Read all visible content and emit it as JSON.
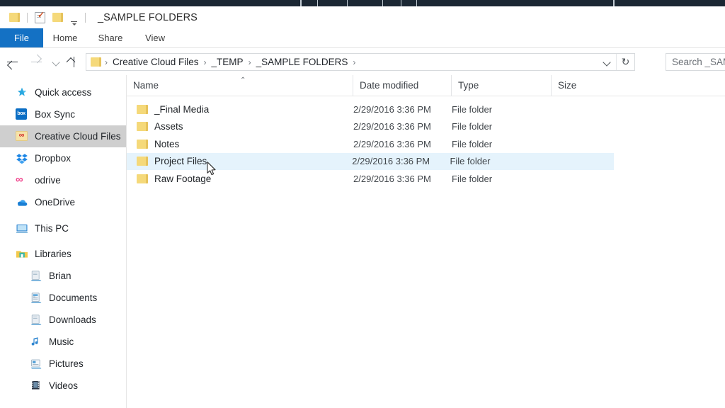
{
  "window": {
    "title": "_SAMPLE FOLDERS",
    "quick_access_toolbar": [
      {
        "name": "folder-icon",
        "label": ""
      },
      {
        "name": "properties-icon",
        "label": ""
      },
      {
        "name": "new-folder-icon",
        "label": ""
      },
      {
        "name": "customize-dropdown-icon",
        "label": ""
      }
    ]
  },
  "ribbon": {
    "tabs": [
      {
        "label": "File",
        "active": true
      },
      {
        "label": "Home",
        "active": false
      },
      {
        "label": "Share",
        "active": false
      },
      {
        "label": "View",
        "active": false
      }
    ]
  },
  "navigation": {
    "back_tooltip": "Back",
    "forward_tooltip": "Forward",
    "recent_tooltip": "Recent locations",
    "up_tooltip": "Up",
    "breadcrumb": [
      "Creative Cloud Files",
      "_TEMP",
      "_SAMPLE FOLDERS"
    ],
    "separator": "›",
    "refresh_glyph": "↻",
    "dropdown_glyph": "⌄"
  },
  "search": {
    "placeholder": "Search _SAM",
    "value": ""
  },
  "sidebar": {
    "items": [
      {
        "label": "Quick access",
        "icon": "star-icon",
        "selected": false,
        "child": false
      },
      {
        "label": "Box Sync",
        "icon": "box-sync-icon",
        "selected": false,
        "child": false
      },
      {
        "label": "Creative Cloud Files",
        "icon": "creative-cloud-folder-icon",
        "selected": true,
        "child": false
      },
      {
        "label": "Dropbox",
        "icon": "dropbox-icon",
        "selected": false,
        "child": false
      },
      {
        "label": "odrive",
        "icon": "odrive-icon",
        "selected": false,
        "child": false
      },
      {
        "label": "OneDrive",
        "icon": "onedrive-cloud-icon",
        "selected": false,
        "child": false
      },
      {
        "label": "This PC",
        "icon": "monitor-icon",
        "selected": false,
        "child": false
      },
      {
        "label": "Libraries",
        "icon": "libraries-folder-icon",
        "selected": false,
        "child": false
      },
      {
        "label": "Brian",
        "icon": "library-icon",
        "selected": false,
        "child": true
      },
      {
        "label": "Documents",
        "icon": "documents-library-icon",
        "selected": false,
        "child": true
      },
      {
        "label": "Downloads",
        "icon": "downloads-library-icon",
        "selected": false,
        "child": true
      },
      {
        "label": "Music",
        "icon": "music-note-icon",
        "selected": false,
        "child": true
      },
      {
        "label": "Pictures",
        "icon": "pictures-library-icon",
        "selected": false,
        "child": true
      },
      {
        "label": "Videos",
        "icon": "videos-library-icon",
        "selected": false,
        "child": true
      }
    ]
  },
  "file_list": {
    "columns": [
      {
        "label": "Name",
        "sorted": true,
        "sort_glyph": "⌃"
      },
      {
        "label": "Date modified",
        "sorted": false,
        "sort_glyph": ""
      },
      {
        "label": "Type",
        "sorted": false,
        "sort_glyph": ""
      },
      {
        "label": "Size",
        "sorted": false,
        "sort_glyph": ""
      }
    ],
    "rows": [
      {
        "name": "_Final Media",
        "date": "2/29/2016 3:36 PM",
        "type": "File folder",
        "size": "",
        "hover": false
      },
      {
        "name": "Assets",
        "date": "2/29/2016 3:36 PM",
        "type": "File folder",
        "size": "",
        "hover": false
      },
      {
        "name": "Notes",
        "date": "2/29/2016 3:36 PM",
        "type": "File folder",
        "size": "",
        "hover": false
      },
      {
        "name": "Project Files",
        "date": "2/29/2016 3:36 PM",
        "type": "File folder",
        "size": "",
        "hover": true
      },
      {
        "name": "Raw Footage",
        "date": "2/29/2016 3:36 PM",
        "type": "File folder",
        "size": "",
        "hover": false
      }
    ]
  },
  "colors": {
    "accent_tab": "#1471c4",
    "row_hover": "#e5f3fc",
    "sidebar_selected": "#cfcfcf",
    "folder_yellow": "#f5d97a",
    "title_bar_strip": "#1b2733"
  }
}
